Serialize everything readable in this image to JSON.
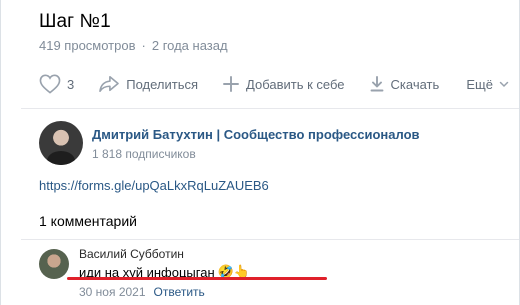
{
  "video": {
    "title": "Шаг №1",
    "views": "419 просмотров",
    "separator": "·",
    "age": "2 года назад"
  },
  "actions": {
    "like_count": "3",
    "share_label": "Поделиться",
    "add_label": "Добавить к себе",
    "download_label": "Скачать",
    "more_label": "Ещё"
  },
  "channel": {
    "name": "Дмитрий Батухтин | Сообщество профессионалов",
    "subscribers": "1 818 подписчиков"
  },
  "description": {
    "link": "https://forms.gle/upQaLkxRqLuZAUEB6"
  },
  "comments": {
    "count_label": "1 комментарий",
    "items": [
      {
        "author": "Василий Субботин",
        "text": "иди на хуй инфоцыган",
        "emoji": "🤣👆",
        "date": "30 ноя 2021",
        "reply_label": "Ответить"
      }
    ]
  },
  "colors": {
    "link": "#2a5885",
    "muted": "#818c99",
    "icon": "#99a2ad",
    "highlight": "#e0202a"
  }
}
